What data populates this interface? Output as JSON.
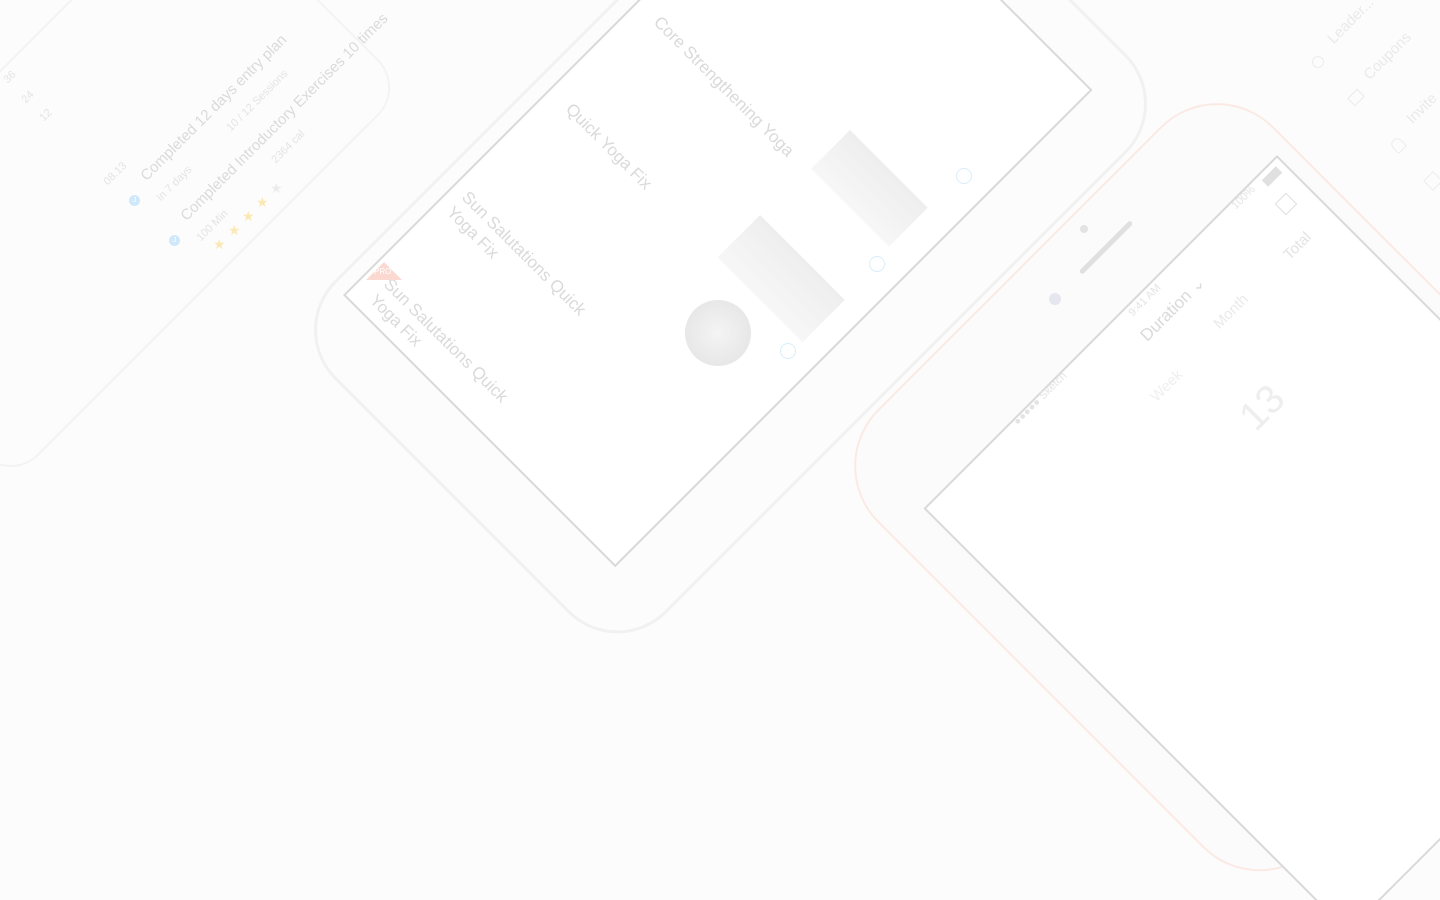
{
  "left_phone": {
    "axis": [
      "36",
      "24",
      "12"
    ],
    "timeline": [
      {
        "date": "08.13",
        "title": "Completed 12 days entry plan",
        "sub1": "In 7 days",
        "sub2": "10 / 12 Sessions",
        "badge": "J"
      },
      {
        "title": "Completed  Introductory Exercises 10 times",
        "sub1": "100 Min",
        "sub2": "2364 cal",
        "badge": "J",
        "rating": 4
      }
    ],
    "stars": [
      "★",
      "★",
      "★",
      "★",
      "★"
    ]
  },
  "middle_phone": {
    "items": [
      {
        "title": "Core Strengthening Yoga"
      },
      {
        "title": "Quick Yoga Fix"
      },
      {
        "title_l1": "Sun Salutations Quick",
        "title_l2": "Yoga Fix"
      },
      {
        "title_l1": "Sun Salutations Quick",
        "title_l2": "Yoga Fix",
        "tag": "PRO"
      }
    ]
  },
  "right_phone": {
    "status": {
      "carrier": "●●●●● Sketch",
      "time": "9:41 AM",
      "battery": "100%"
    },
    "dropdown": "Duration ⌄",
    "tabs": [
      "Week",
      "Month",
      "Total"
    ],
    "value": "13"
  },
  "side_menu": [
    "Leader...",
    "Coupons",
    "Invite"
  ],
  "colors": {
    "accent": "#5bb8f5",
    "star": "#f7c948",
    "pro": "#f08a75"
  }
}
